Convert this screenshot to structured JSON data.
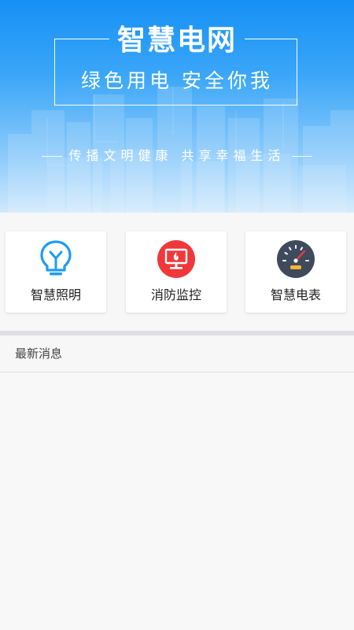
{
  "banner": {
    "title": "智慧电网",
    "subtitle": "绿色用电 安全你我",
    "slogan": "传播文明健康 共享幸福生活"
  },
  "cards": [
    {
      "label": "智慧照明",
      "icon": "lightbulb-icon",
      "color": "#1e9cf0"
    },
    {
      "label": "消防监控",
      "icon": "fire-monitor-icon",
      "color": "#f0383b"
    },
    {
      "label": "智慧电表",
      "icon": "speedometer-icon",
      "color": "#3f4a5c"
    }
  ],
  "news": {
    "title": "最新消息"
  }
}
